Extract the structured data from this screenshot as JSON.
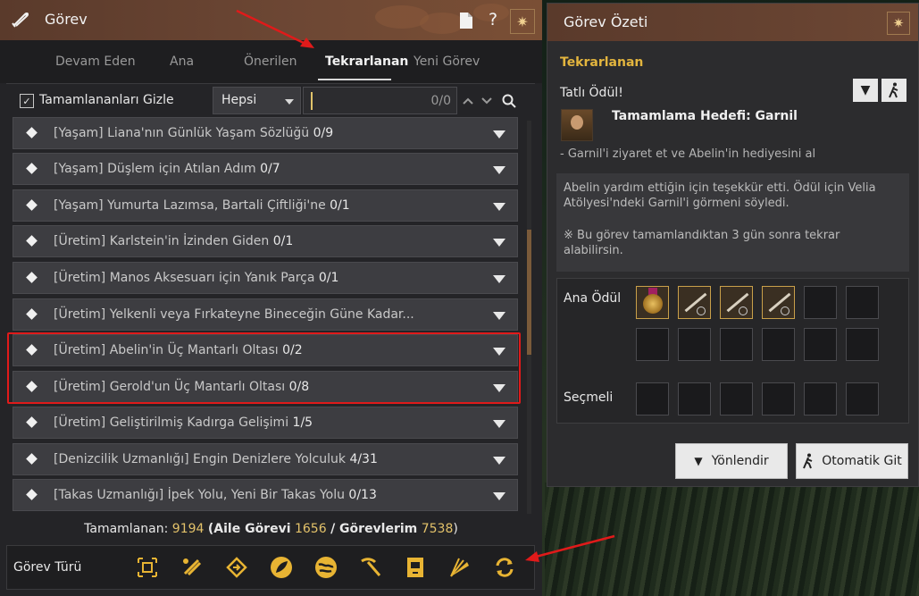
{
  "left_window": {
    "title": "Görev",
    "tabs": [
      {
        "label": "Devam Eden",
        "active": false
      },
      {
        "label": "Ana",
        "active": false
      },
      {
        "label": "Önerilen",
        "active": false
      },
      {
        "label": "Tekrarlanan",
        "active": true
      },
      {
        "label": "Yeni Görev",
        "active": false
      }
    ],
    "filter": {
      "hide_completed_label": "Tamamlananları Gizle",
      "hide_completed_checked": true,
      "category_select": "Hepsi",
      "search_value": "",
      "search_count": "0/0"
    },
    "quests": [
      {
        "name": "[Yaşam] Liana'nın Günlük Yaşam Sözlüğü",
        "progress": "0/9"
      },
      {
        "name": "[Yaşam] Düşlem için Atılan Adım",
        "progress": "0/7"
      },
      {
        "name": "[Yaşam] Yumurta Lazımsa, Bartali Çiftliği'ne",
        "progress": "0/1"
      },
      {
        "name": "[Üretim] Karlstein'in İzinden Giden",
        "progress": "0/1"
      },
      {
        "name": "[Üretim] Manos Aksesuarı için Yanık Parça",
        "progress": "0/1"
      },
      {
        "name": "[Üretim] Yelkenli veya Fırkateyne Bineceğin Güne Kadar...",
        "progress": ""
      },
      {
        "name": "[Üretim] Abelin'in Üç Mantarlı Oltası",
        "progress": "0/2"
      },
      {
        "name": "[Üretim] Gerold'un Üç Mantarlı Oltası",
        "progress": "0/8"
      },
      {
        "name": "[Üretim] Geliştirilmiş Kadırga Gelişimi",
        "progress": "1/5"
      },
      {
        "name": "[Denizcilik Uzmanlığı] Engin Denizlere Yolculuk",
        "progress": "4/31"
      },
      {
        "name": "[Takas Uzmanlığı] İpek Yolu, Yeni Bir Takas Yolu",
        "progress": "0/13"
      }
    ],
    "stats": {
      "completed_label": "Tamamlanan:",
      "completed_value": "9194",
      "family_label": "(Aile Görevi",
      "family_value": "1656",
      "mine_label": "/ Görevlerim",
      "mine_value": "7538",
      "close_paren": ")"
    },
    "quest_type": {
      "label": "Görev Türü",
      "icons": [
        "crosshair-icon",
        "scroll-icon",
        "diamond-arrow-icon",
        "leaf-circle-icon",
        "globe-icon",
        "pickaxe-icon",
        "book-icon",
        "fan-icon",
        "refresh-icon"
      ]
    }
  },
  "right_window": {
    "title": "Görev Özeti",
    "section": "Tekrarlanan",
    "reward_title": "Tatlı Ödül!",
    "goal": "Tamamlama Hedefi: Garnil",
    "objective": "- Garnil'i ziyaret et ve Abelin'in hediyesini al",
    "description_lines": [
      "Abelin yardım ettiğin için teşekkür etti. Ödül için Velia",
      "Atölyesi'ndeki Garnil'i görmeni söyledi."
    ],
    "note_lines": [
      "※ Bu görev tamamlandıktan 3 gün sonra tekrar",
      "alabilirsin."
    ],
    "main_reward_label": "Ana Ödül",
    "optional_label": "Seçmeli",
    "navigate_button": "Yönlendir",
    "autopath_button": "Otomatik Git"
  },
  "colors": {
    "accent_gold": "#e3b53e",
    "highlight_red": "#e01a1a",
    "title_brown": "#6d4734"
  }
}
